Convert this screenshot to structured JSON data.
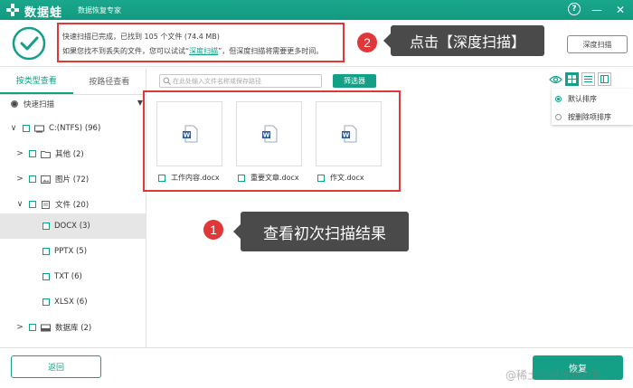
{
  "titlebar": {
    "app_name": "数据蛙",
    "subtitle": "数据恢复专家",
    "icons": [
      "help-icon",
      "minimize-icon",
      "close-icon"
    ],
    "help_glyph": "?",
    "minimize_glyph": "—",
    "close_glyph": "✕"
  },
  "header": {
    "status_line1": "快速扫描已完成，已找到 105 个文件 (74.4 MB)",
    "status_line2_pre": "如果您找不到丢失的文件，您可以试试“",
    "status_line2_link": "深度扫描",
    "status_line2_post": "”，但深度扫描将需要更多时间。",
    "deep_scan_button": "深度扫描",
    "annotation2_number": "2",
    "annotation2_text": "点击【深度扫描】"
  },
  "sidebar": {
    "tabs": [
      {
        "label": "按类型查看",
        "active": true
      },
      {
        "label": "按路径查看",
        "active": false
      }
    ],
    "scan_mode": "快速扫描",
    "tree": [
      {
        "label": "C:(NTFS) (96)",
        "expander": "∨",
        "icon": "drive-icon"
      },
      {
        "label": "其他 (2)",
        "expander": ">",
        "icon": "folder-icon"
      },
      {
        "label": "图片 (72)",
        "expander": ">",
        "icon": "image-icon"
      },
      {
        "label": "文件 (20)",
        "expander": "∨",
        "icon": "document-icon"
      },
      {
        "label": "DOCX (3)",
        "expander": "",
        "icon": "",
        "selected": true
      },
      {
        "label": "PPTX (5)",
        "expander": "",
        "icon": ""
      },
      {
        "label": "TXT (6)",
        "expander": "",
        "icon": ""
      },
      {
        "label": "XLSX (6)",
        "expander": "",
        "icon": ""
      },
      {
        "label": "数据库 (2)",
        "expander": ">",
        "icon": "database-icon"
      }
    ]
  },
  "toolbar": {
    "search_placeholder": "在此处输入文件名称或保存路径",
    "filter_button": "筛选器",
    "sort_options": [
      {
        "label": "默认排序",
        "selected": true
      },
      {
        "label": "按删除项排序",
        "selected": false
      }
    ]
  },
  "files": [
    {
      "name": "工作内容.docx"
    },
    {
      "name": "重要文章.docx"
    },
    {
      "name": "作文.docx"
    }
  ],
  "annotation1": {
    "number": "1",
    "text": "查看初次扫描结果"
  },
  "footer": {
    "back_button": "返回",
    "recover_button": "恢复",
    "watermark": "@稀土掘金技术社区"
  },
  "colors": {
    "accent": "#13a086",
    "highlight": "#e03838"
  }
}
